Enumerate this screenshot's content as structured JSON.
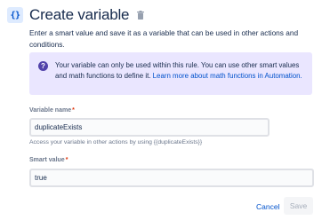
{
  "header": {
    "icon_glyph": "{}",
    "title": "Create variable"
  },
  "description": "Enter a smart value and save it as a variable that can be used in other actions and conditions.",
  "info": {
    "icon": "question-icon",
    "text": "Your variable can only be used within this rule. You can use other smart values and math functions to define it. ",
    "link_text": "Learn more about math functions in Automation."
  },
  "variable_name": {
    "label": "Variable name",
    "required_mark": "*",
    "value": "duplicateExists",
    "helper": "Access your variable in other actions by using {{duplicateExists}}"
  },
  "smart_value": {
    "label": "Smart value",
    "required_mark": "*",
    "value": "true"
  },
  "buttons": {
    "cancel": "Cancel",
    "save": "Save"
  },
  "colors": {
    "info_background": "#eae6ff",
    "info_icon": "#5243aa",
    "link": "#0052cc",
    "required": "#de350b"
  }
}
